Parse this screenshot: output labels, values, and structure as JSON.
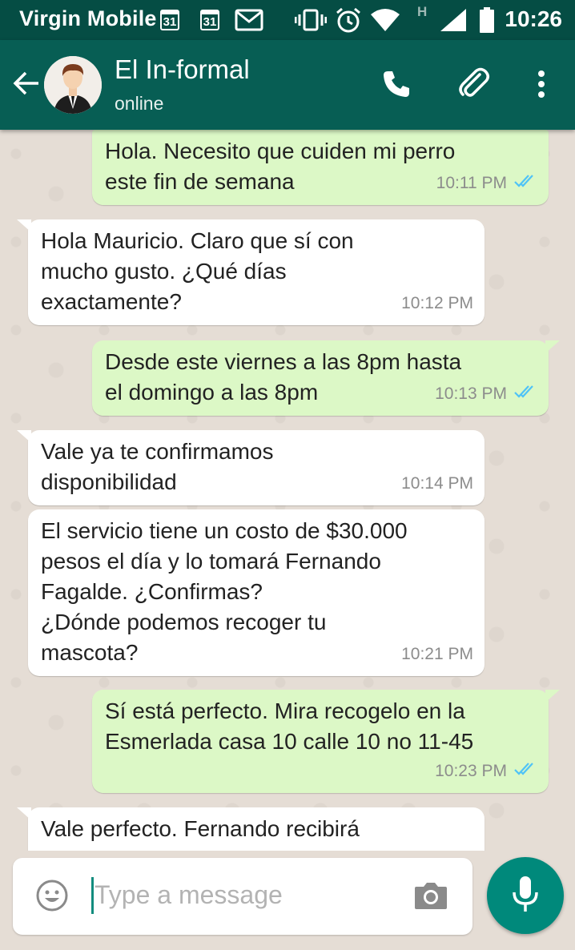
{
  "status_bar": {
    "carrier": "Virgin Mobile",
    "calendar_day_1": "31",
    "calendar_day_2": "31",
    "network_indicator": "H",
    "time": "10:26",
    "icons": [
      "calendar-icon",
      "calendar-icon",
      "gmail-icon",
      "vibrate-icon",
      "alarm-icon",
      "wifi-icon",
      "signal-icon",
      "battery-icon"
    ]
  },
  "header": {
    "contact_name": "El In-formal",
    "status": "online",
    "icons": [
      "back-arrow-icon",
      "avatar",
      "phone-icon",
      "attach-icon",
      "more-vert-icon"
    ]
  },
  "messages": [
    {
      "direction": "out",
      "text": "Hola. Necesito que cuiden mi perro\neste fin de semana",
      "time": "10:11 PM",
      "read": true
    },
    {
      "direction": "in",
      "text": "Hola Mauricio. Claro que sí con\nmucho gusto. ¿Qué días\nexactamente?",
      "time": "10:12 PM"
    },
    {
      "direction": "out",
      "text": "Desde este viernes a las 8pm hasta\nel domingo a las 8pm",
      "time": "10:13 PM",
      "read": true
    },
    {
      "direction": "in",
      "text": "Vale ya te confirmamos\ndisponibilidad",
      "time": "10:14 PM"
    },
    {
      "direction": "in",
      "text": "El servicio tiene un costo de $30.000\npesos el día y lo tomará Fernando\nFagalde. ¿Confirmas?\n¿Dónde podemos recoger tu\nmascota?",
      "time": "10:21 PM"
    },
    {
      "direction": "out",
      "text": "Sí está perfecto. Mira recogelo en la\nEsmerlada casa 10 calle 10 no 11-45",
      "time": "10:23 PM",
      "read": true
    },
    {
      "direction": "in",
      "text": "Vale perfecto. Fernando recibirá",
      "time": ""
    }
  ],
  "composer": {
    "placeholder": "Type a message"
  },
  "colors": {
    "status_bar": "#054d44",
    "app_bar": "#075e54",
    "outgoing_bubble": "#dcf8c6",
    "incoming_bubble": "#ffffff",
    "read_ticks": "#4fc3f7",
    "mic_button": "#00897b",
    "chat_background": "#e5ddd5"
  }
}
